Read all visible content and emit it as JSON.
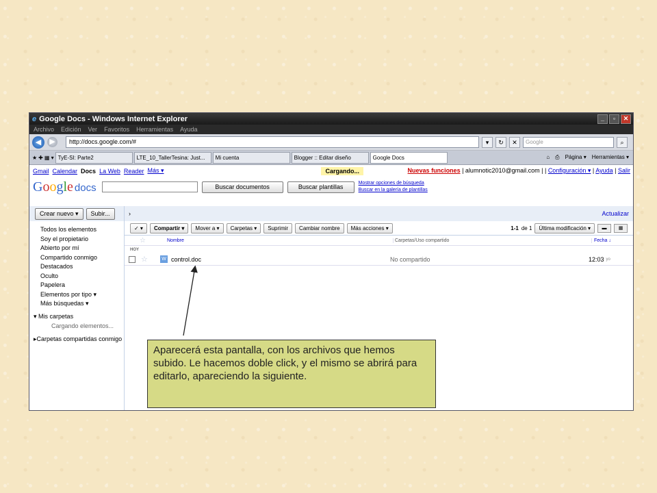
{
  "window": {
    "title": "Google Docs - Windows Internet Explorer",
    "menu": [
      "Archivo",
      "Edición",
      "Ver",
      "Favoritos",
      "Herramientas",
      "Ayuda"
    ],
    "url": "http://docs.google.com/#",
    "search_placeholder": "Google",
    "tabs": [
      "TyE-SI: Parte2",
      "LTE_10_TallerTesina: Just...",
      "Mi cuenta",
      "Blogger :: Editar diseño",
      "Google Docs"
    ],
    "toolbar_right": [
      "Página ▾",
      "Herramientas ▾"
    ]
  },
  "gbar": {
    "links": [
      "Gmail",
      "Calendar",
      "Docs",
      "La Web",
      "Reader",
      "Más ▾"
    ],
    "loading": "Cargando...",
    "new_features": "Nuevas funciones",
    "account": "| alumnotic2010@gmail.com | |",
    "config": "Configuración ▾",
    "sep": "|",
    "help": "Ayuda",
    "exit": "Salir"
  },
  "header": {
    "logo": "Google",
    "logo_suffix": "docs",
    "search_docs": "Buscar documentos",
    "search_templates": "Buscar plantillas",
    "link_options": "Mostrar opciones de búsqueda",
    "link_gallery": "Buscar en la galería de plantillas"
  },
  "sidebar": {
    "create": "Crear nuevo ▾",
    "upload": "Subir...",
    "items": [
      "Todos los elementos",
      "Soy el propietario",
      "Abierto por mí",
      "Compartido conmigo",
      "Destacados",
      "Oculto",
      "Papelera",
      "Elementos por tipo ▾",
      "Más búsquedas ▾"
    ],
    "my_folders": "Mis carpetas",
    "loading_elements": "Cargando elementos...",
    "shared_folders": "Carpetas compartidas conmigo"
  },
  "main": {
    "update": "Actualizar",
    "toolbar": {
      "check": "✓ ▾",
      "share": "Compartir ▾",
      "move": "Mover a ▾",
      "folders": "Carpetas ▾",
      "delete": "Suprimir",
      "rename": "Cambiar nombre",
      "more": "Más acciones ▾",
      "range": "1-1",
      "of": "de 1",
      "sort": "Última modificación ▾"
    },
    "columns": {
      "name": "Nombre",
      "folders": "Carpetas/Uso compartido",
      "date": "Fecha ↓"
    },
    "group": "HOY",
    "file": {
      "name": "control.doc",
      "shared": "No compartido",
      "time": "12:03",
      "by": "yo"
    }
  },
  "callout": {
    "text": "Aparecerá esta pantalla, con los archivos que hemos subido. Le hacemos doble click, y el mismo se abrirá para editarlo, apareciendo la siguiente."
  }
}
